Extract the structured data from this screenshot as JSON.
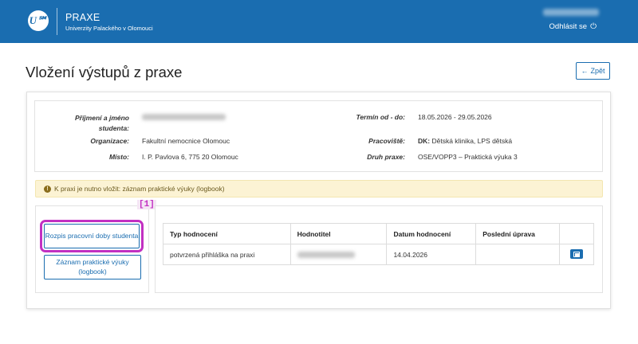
{
  "header": {
    "logo_glyph": "U℠",
    "app_title": "PRAXE",
    "app_subtitle": "Univerzity Palackého v Olomouci",
    "logout_label": "Odhlásit se",
    "logout_icon": "power-icon"
  },
  "page": {
    "title": "Vložení výstupů z praxe",
    "back_label": "Zpět",
    "back_icon": "arrow-left-icon"
  },
  "info": {
    "student_label": "Příjmení a jméno studenta:",
    "termin_label": "Termín od - do:",
    "termin_value": "18.05.2026 - 29.05.2026",
    "organizace_label": "Organizace:",
    "organizace_value": "Fakultní nemocnice Olomouc",
    "pracoviste_label": "Pracoviště:",
    "pracoviste_prefix": "DK:",
    "pracoviste_value": "Dětská klinika, LPS dětská",
    "misto_label": "Místo:",
    "misto_value": "I. P. Pavlova 6, 775 20 Olomouc",
    "druh_label": "Druh praxe:",
    "druh_value": "OSE/VOPP3 – Praktická výuka 3"
  },
  "alert": {
    "icon": "!",
    "text": "K praxi je nutno vložit: záznam praktické výuky (logbook)"
  },
  "annotation_tag": "[1]",
  "buttons": {
    "rozpis": "Rozpis pracovní doby studenta",
    "zaznam": "Záznam praktické výuky (logbook)"
  },
  "table": {
    "headers": [
      "Typ hodnocení",
      "Hodnotitel",
      "Datum hodnocení",
      "Poslední úprava",
      ""
    ],
    "rows": [
      {
        "typ": "potvrzená přihláška na praxi",
        "datum": "14.04.2026",
        "upravа": ""
      }
    ]
  },
  "colors": {
    "brand": "#1a6db0",
    "alert_bg": "#fcf3d4",
    "highlight": "#c230c2"
  }
}
